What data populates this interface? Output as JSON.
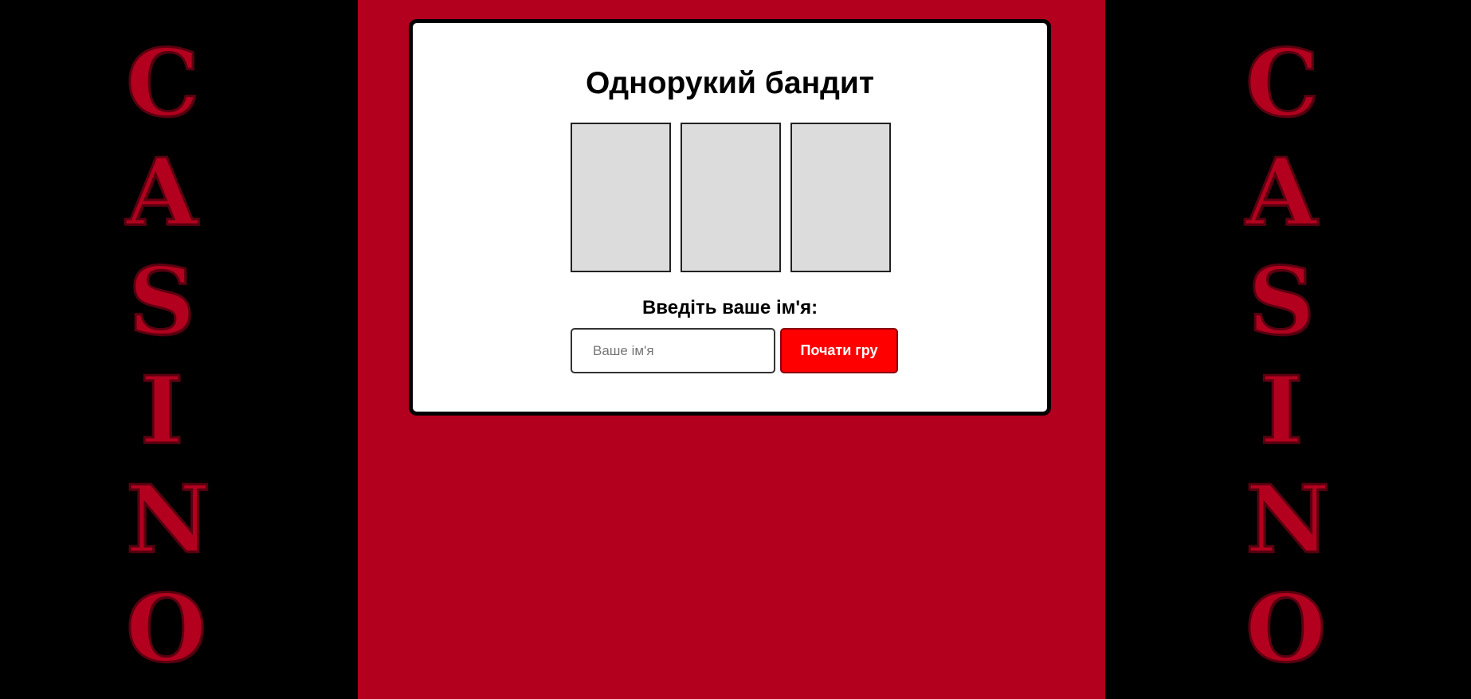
{
  "side_banner": {
    "letters": [
      "C",
      "A",
      "S",
      "I",
      "N",
      "O"
    ]
  },
  "game": {
    "title": "Однорукий бандит",
    "reels": [
      "",
      "",
      ""
    ],
    "name_prompt": "Введіть ваше ім'я:",
    "name_input": {
      "value": "",
      "placeholder": "Ваше ім'я"
    },
    "start_button_label": "Почати гру"
  },
  "colors": {
    "background_sides": "#000000",
    "background_center": "#b3001e",
    "card": "#ffffff",
    "reel": "#dcdcdc",
    "accent_button": "#ff0000",
    "casino_letters": "#b3001e"
  },
  "icons": []
}
